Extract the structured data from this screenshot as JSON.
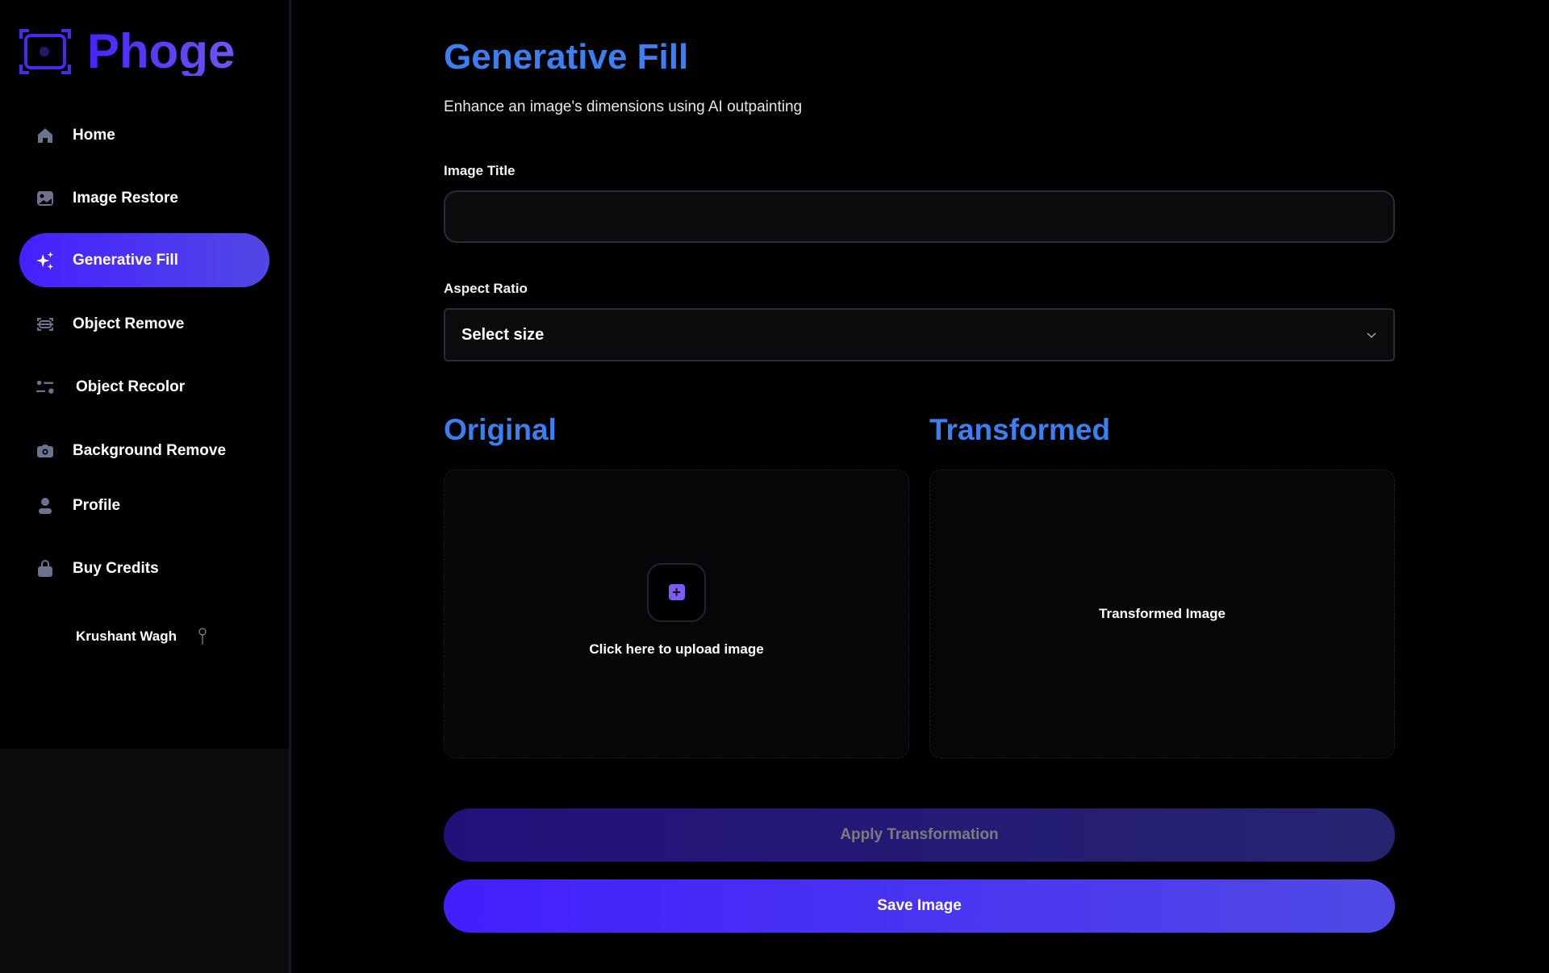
{
  "brand": {
    "name": "Phoge",
    "accent": "#4a22ff"
  },
  "sidebar": {
    "items": [
      {
        "label": "Home",
        "icon": "home-icon"
      },
      {
        "label": "Image Restore",
        "icon": "image-icon"
      },
      {
        "label": "Generative Fill",
        "icon": "sparkles-icon",
        "active": true
      },
      {
        "label": "Object Remove",
        "icon": "scan-icon"
      },
      {
        "label": "Object Recolor",
        "icon": "filter-icon"
      },
      {
        "label": "Background Remove",
        "icon": "camera-icon"
      },
      {
        "label": "Profile",
        "icon": "user-icon"
      },
      {
        "label": "Buy Credits",
        "icon": "bag-icon"
      }
    ],
    "user": {
      "name": "Krushant Wagh"
    }
  },
  "page": {
    "title": "Generative Fill",
    "subtitle": "Enhance an image's dimensions using AI outpainting"
  },
  "form": {
    "image_title_label": "Image Title",
    "image_title_value": "",
    "aspect_label": "Aspect Ratio",
    "aspect_value": "Select size"
  },
  "panels": {
    "original": "Original",
    "transformed": "Transformed",
    "upload_text": "Click here to upload image",
    "transformed_placeholder": "Transformed Image"
  },
  "actions": {
    "apply": "Apply Transformation",
    "save": "Save Image"
  }
}
